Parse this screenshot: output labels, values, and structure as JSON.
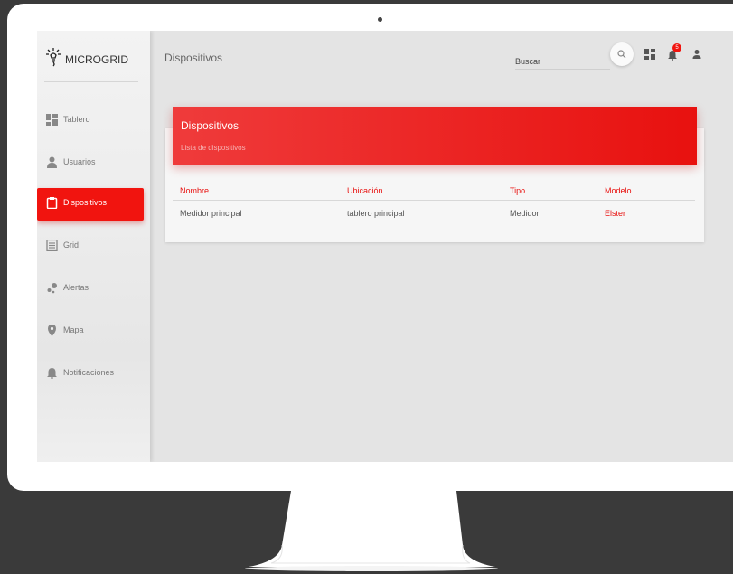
{
  "app": {
    "brand": "MICROGRID"
  },
  "sidebar": {
    "items": [
      {
        "label": "Tablero",
        "icon": "dashboard-icon",
        "active": false
      },
      {
        "label": "Usuarios",
        "icon": "person-icon",
        "active": false
      },
      {
        "label": "Dispositivos",
        "icon": "clipboard-icon",
        "active": true
      },
      {
        "label": "Grid",
        "icon": "grid-list-icon",
        "active": false
      },
      {
        "label": "Alertas",
        "icon": "bubbles-icon",
        "active": false
      },
      {
        "label": "Mapa",
        "icon": "map-pin-icon",
        "active": false
      },
      {
        "label": "Notificaciones",
        "icon": "bell-icon",
        "active": false
      }
    ]
  },
  "header": {
    "title": "Dispositivos",
    "search_placeholder": "Buscar",
    "notification_count": "5"
  },
  "card": {
    "title": "Dispositivos",
    "subtitle": "Lista de dispositivos",
    "columns": [
      "Nombre",
      "Ubicación",
      "Tipo",
      "Modelo"
    ],
    "rows": [
      [
        "Medidor principal",
        "tablero principal",
        "Medidor",
        "Elster"
      ]
    ]
  },
  "colors": {
    "accent": "#f1140f",
    "sidebar_bg": "#efefef",
    "content_bg": "#e4e4e4",
    "frame": "#3a3a3a"
  }
}
